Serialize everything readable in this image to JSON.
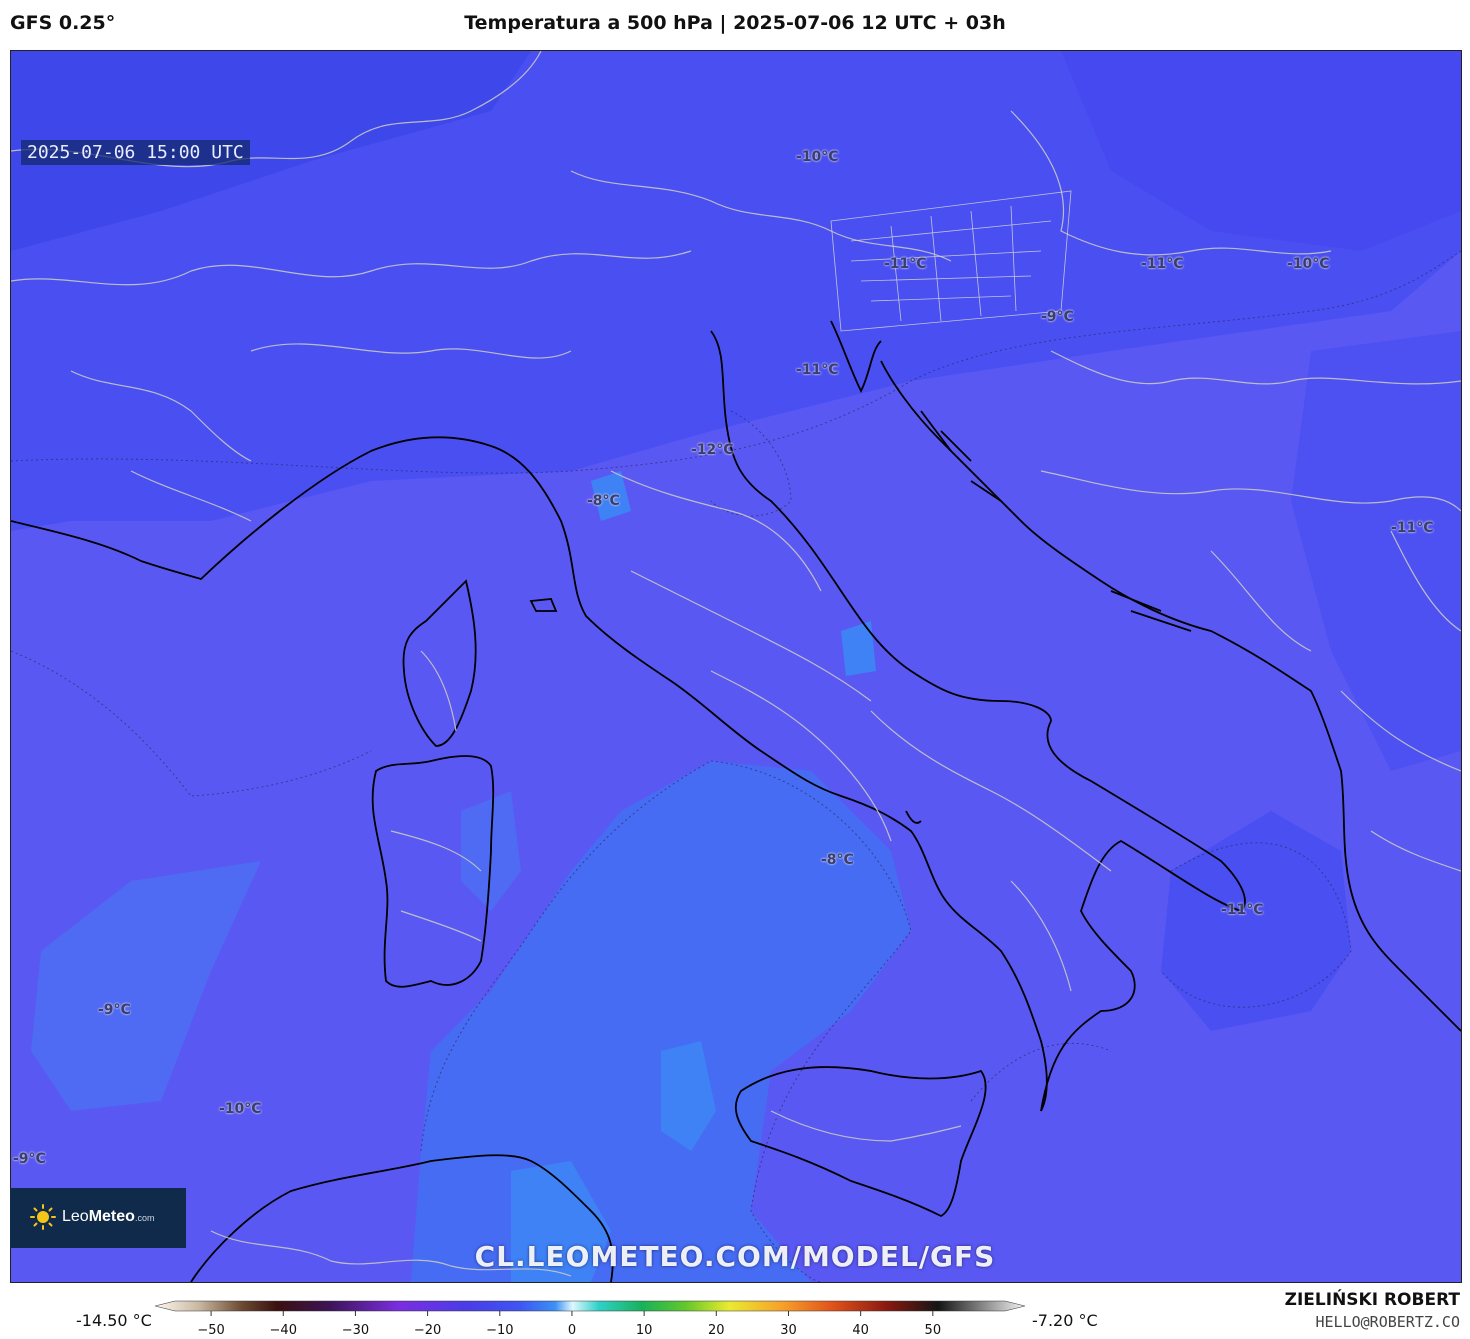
{
  "header": {
    "model": "GFS 0.25°",
    "title": "Temperatura a 500 hPa | 2025-07-06 12 UTC + 03h"
  },
  "map": {
    "valid_time": "2025-07-06 15:00 UTC",
    "temperature_labels": [
      "-10°C",
      "-11°C",
      "-11°C",
      "-10°C",
      "-9°C",
      "-11°C",
      "-12°C",
      "-8°C",
      "-11°C",
      "-8°C",
      "-11°C",
      "-9°C",
      "-10°C",
      "-9°C"
    ],
    "colors": {
      "background": "#5a58f2",
      "cold": "#3f4ef0",
      "warm": "#3f78f5",
      "coast": "#000000",
      "borders": "#c8c8c8"
    }
  },
  "branding": {
    "logo_leo": "Leo",
    "logo_meteo": "Meteo",
    "logo_com": ".com",
    "watermark": "CL.LEOMETEO.COM/MODEL/GFS"
  },
  "legend": {
    "min_label": "-14.50 °C",
    "max_label": "-7.20 °C",
    "ticks": [
      "−50",
      "−40",
      "−30",
      "−20",
      "−10",
      "0",
      "10",
      "20",
      "30",
      "40",
      "50"
    ],
    "range": [
      -55,
      60
    ]
  },
  "footer": {
    "author": "ZIELIŃSKI ROBERT",
    "contact": "HELLO@ROBERTZ.CO"
  }
}
